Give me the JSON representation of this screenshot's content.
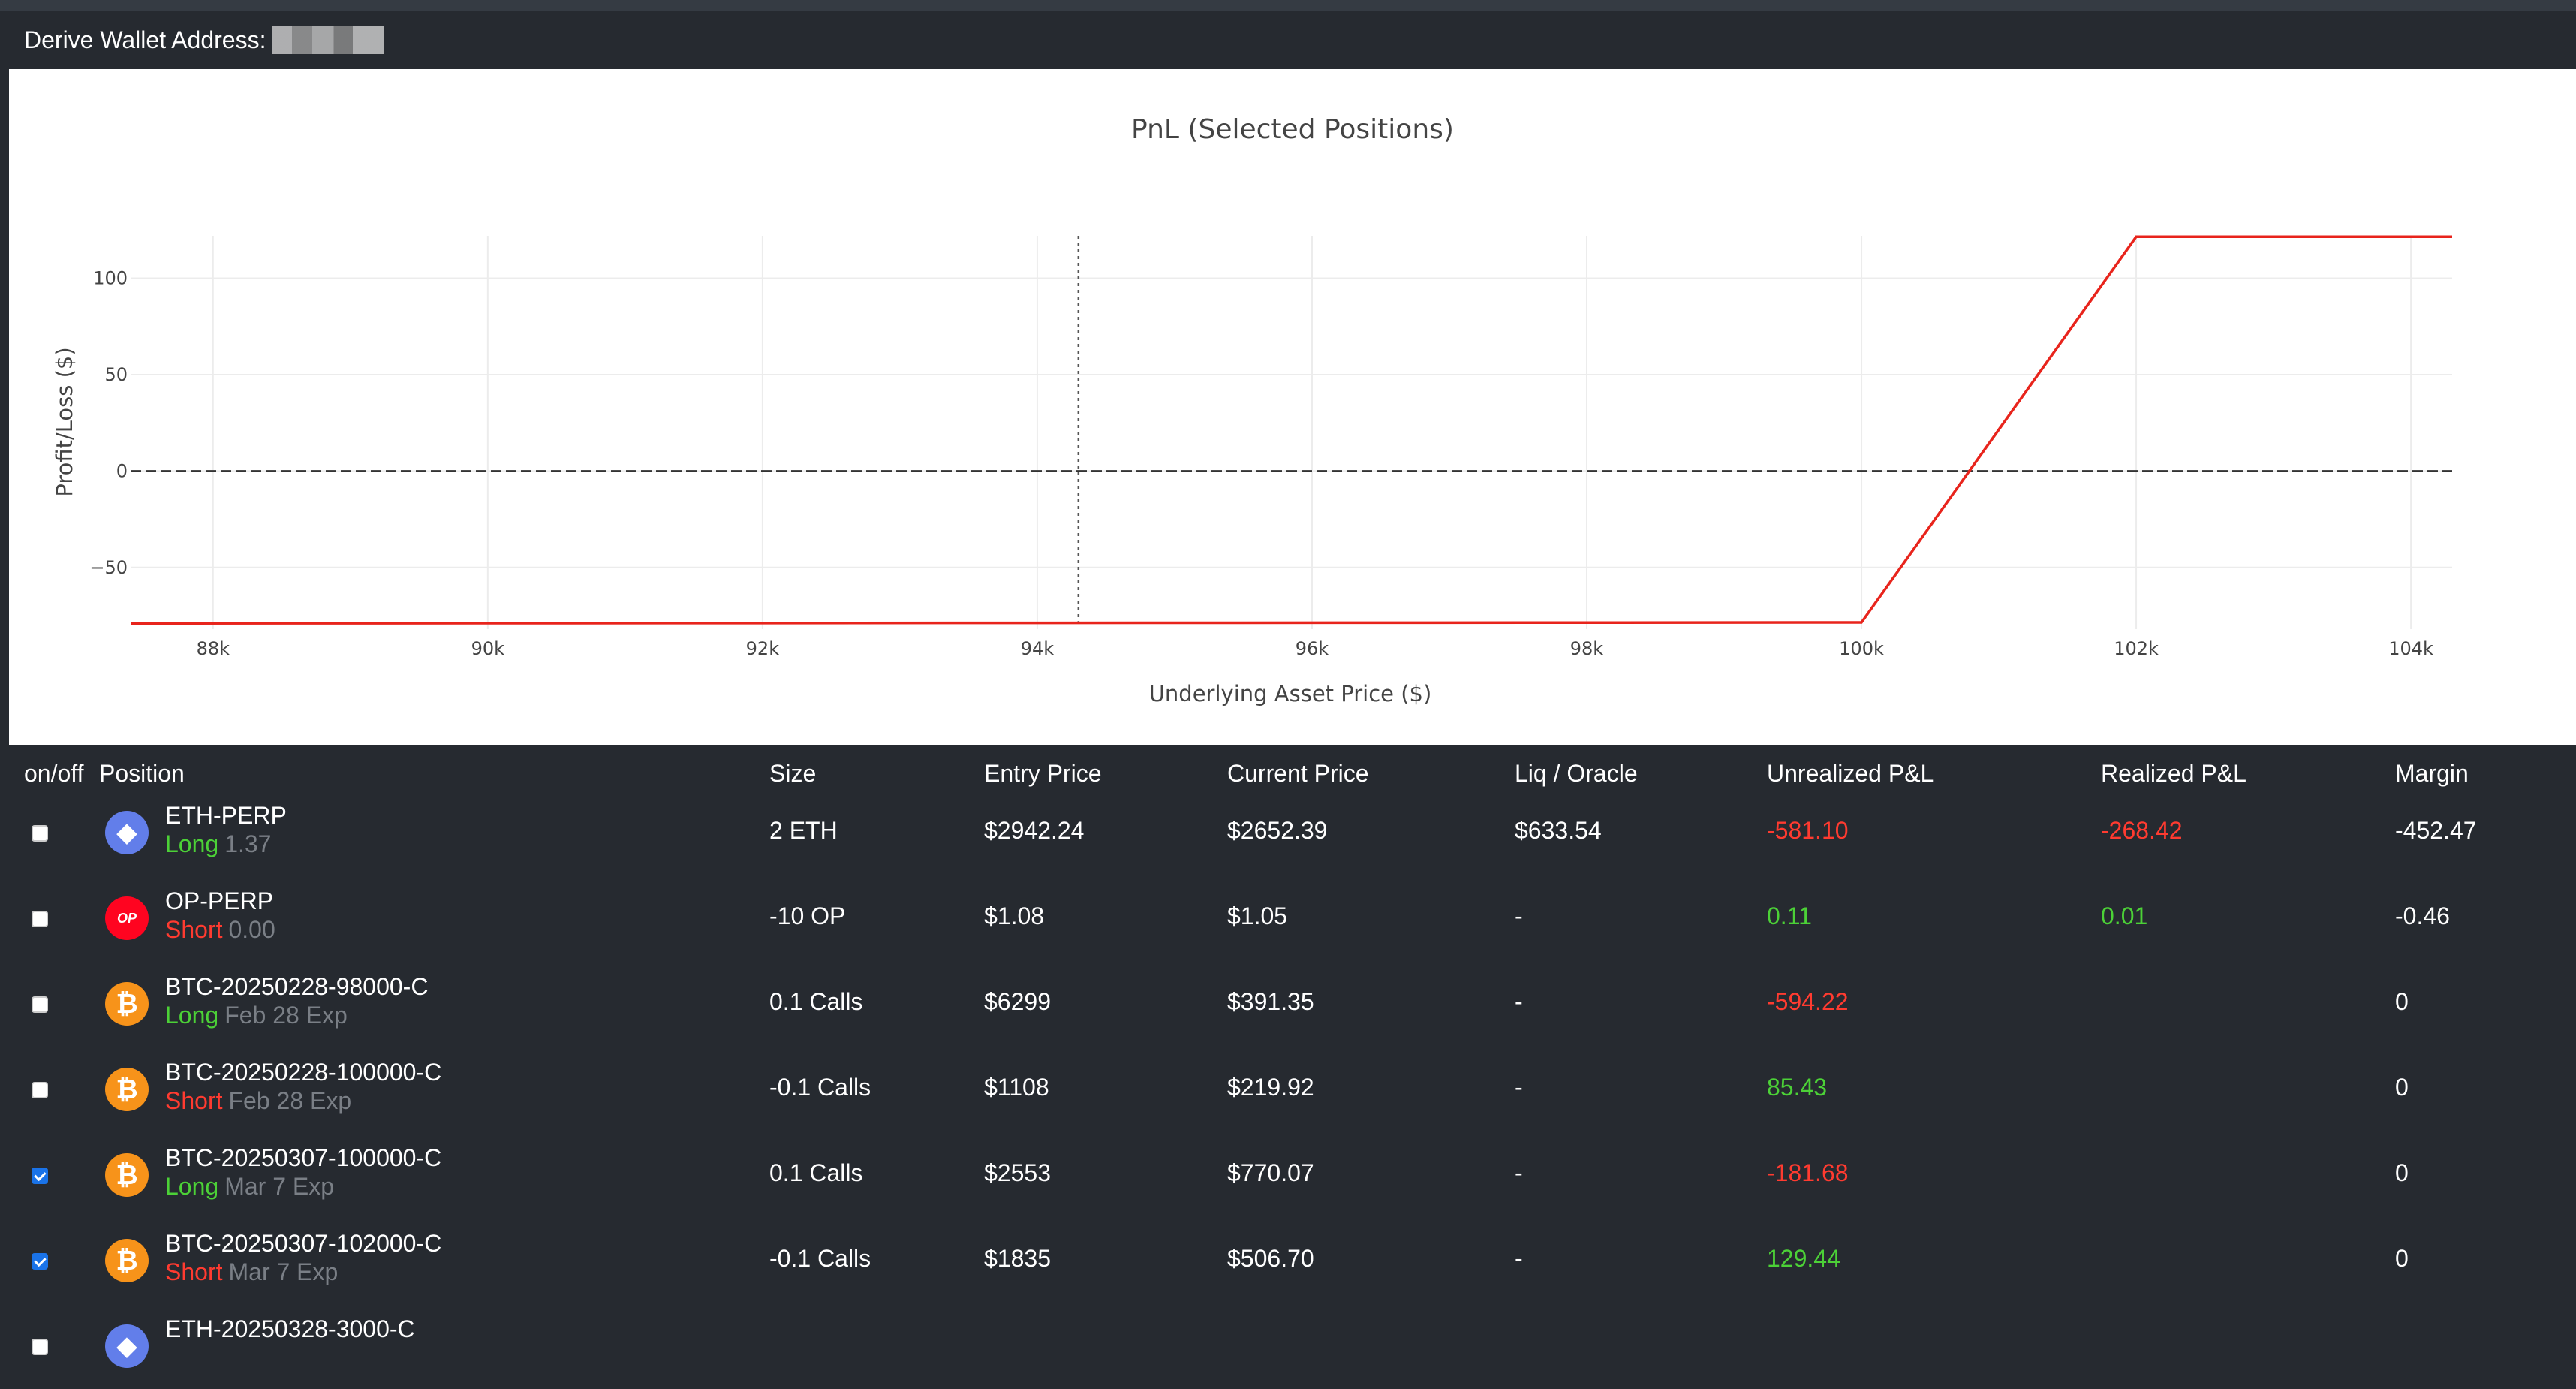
{
  "header": {
    "wallet_label": "Derive Wallet Address:"
  },
  "chart_data": {
    "type": "line",
    "title": "PnL (Selected Positions)",
    "xlabel": "Underlying Asset Price ($)",
    "ylabel": "Profit/Loss ($)",
    "xlim": [
      87400,
      104300
    ],
    "ylim": [
      -82,
      122
    ],
    "x_ticks": [
      88000,
      90000,
      92000,
      94000,
      96000,
      98000,
      100000,
      102000,
      104000
    ],
    "x_tick_labels": [
      "88k",
      "90k",
      "92k",
      "94k",
      "96k",
      "98k",
      "100k",
      "102k",
      "104k"
    ],
    "y_ticks": [
      -50,
      0,
      50,
      100
    ],
    "y_tick_labels": [
      "−50",
      "0",
      "50",
      "100"
    ],
    "series": [
      {
        "x": [
          87400,
          100000,
          102000,
          104300
        ],
        "y": [
          -79,
          -78.5,
          121.5,
          121.5
        ],
        "color": "#e8241c"
      }
    ],
    "reference_lines": {
      "current_price_x": 94300,
      "zero_y": 0
    },
    "grid": true
  },
  "table": {
    "headers": [
      "on/off",
      "Position",
      "Size",
      "Entry Price",
      "Current Price",
      "Liq / Oracle",
      "Unrealized P&L",
      "Realized P&L",
      "Margin"
    ],
    "rows": [
      {
        "checked": false,
        "coin": "eth",
        "coin_glyph": "◆",
        "name": "ETH-PERP",
        "side": "Long",
        "side_class": "long",
        "detail": "1.37",
        "size": "2 ETH",
        "entry": "$2942.24",
        "current": "$2652.39",
        "liq": "$633.54",
        "unrealized": "-581.10",
        "unrealized_class": "red",
        "realized": "-268.42",
        "realized_class": "red",
        "margin": "-452.47"
      },
      {
        "checked": false,
        "coin": "op",
        "coin_glyph": "OP",
        "name": "OP-PERP",
        "side": "Short",
        "side_class": "short",
        "detail": "0.00",
        "size": "-10 OP",
        "entry": "$1.08",
        "current": "$1.05",
        "liq": "-",
        "unrealized": "0.11",
        "unrealized_class": "green",
        "realized": "0.01",
        "realized_class": "green",
        "margin": "-0.46"
      },
      {
        "checked": false,
        "coin": "btc",
        "coin_glyph": "₿",
        "name": "BTC-20250228-98000-C",
        "side": "Long",
        "side_class": "long",
        "detail": "Feb 28 Exp",
        "size": "0.1 Calls",
        "entry": "$6299",
        "current": "$391.35",
        "liq": "-",
        "unrealized": "-594.22",
        "unrealized_class": "red",
        "realized": "",
        "realized_class": "",
        "margin": "0"
      },
      {
        "checked": false,
        "coin": "btc",
        "coin_glyph": "₿",
        "name": "BTC-20250228-100000-C",
        "side": "Short",
        "side_class": "short",
        "detail": "Feb 28 Exp",
        "size": "-0.1 Calls",
        "entry": "$1108",
        "current": "$219.92",
        "liq": "-",
        "unrealized": "85.43",
        "unrealized_class": "green",
        "realized": "",
        "realized_class": "",
        "margin": "0"
      },
      {
        "checked": true,
        "coin": "btc",
        "coin_glyph": "₿",
        "name": "BTC-20250307-100000-C",
        "side": "Long",
        "side_class": "long",
        "detail": "Mar 7 Exp",
        "size": "0.1 Calls",
        "entry": "$2553",
        "current": "$770.07",
        "liq": "-",
        "unrealized": "-181.68",
        "unrealized_class": "red",
        "realized": "",
        "realized_class": "",
        "margin": "0"
      },
      {
        "checked": true,
        "coin": "btc",
        "coin_glyph": "₿",
        "name": "BTC-20250307-102000-C",
        "side": "Short",
        "side_class": "short",
        "detail": "Mar 7 Exp",
        "size": "-0.1 Calls",
        "entry": "$1835",
        "current": "$506.70",
        "liq": "-",
        "unrealized": "129.44",
        "unrealized_class": "green",
        "realized": "",
        "realized_class": "",
        "margin": "0"
      },
      {
        "checked": false,
        "coin": "eth",
        "coin_glyph": "◆",
        "name": "ETH-20250328-3000-C",
        "side": "",
        "side_class": "long",
        "detail": "",
        "size": "",
        "entry": "",
        "current": "",
        "liq": "",
        "unrealized": "",
        "unrealized_class": "",
        "realized": "",
        "realized_class": "",
        "margin": ""
      }
    ]
  }
}
